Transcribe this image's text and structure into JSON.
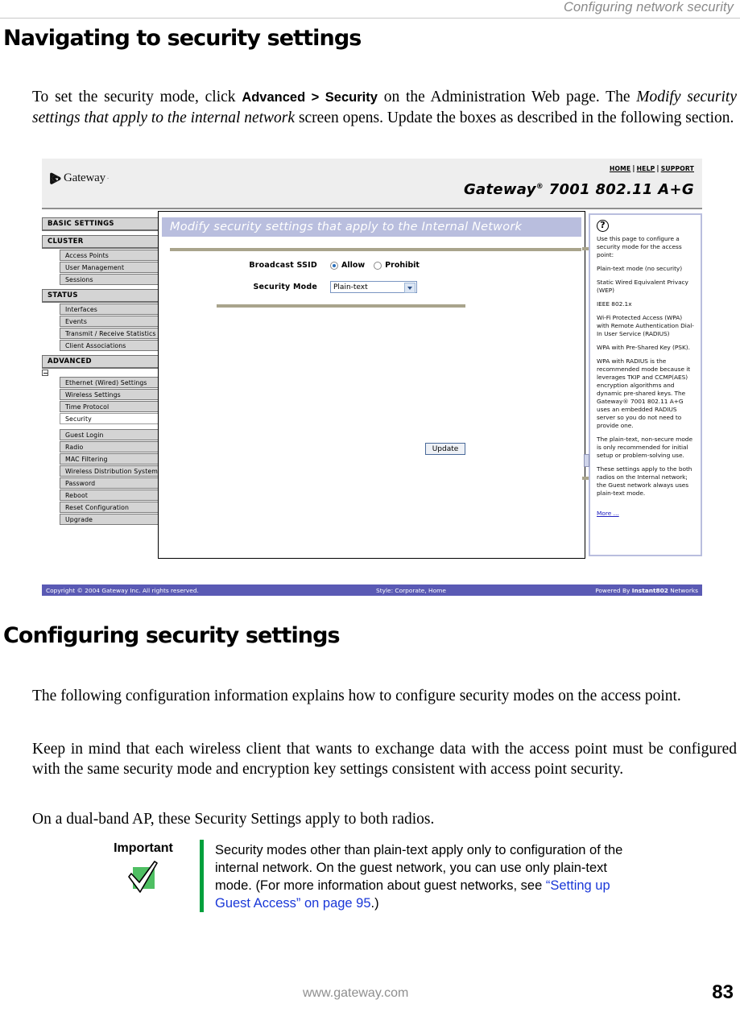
{
  "running_head": "Configuring network security",
  "sections": {
    "nav_heading": "Navigating to security settings",
    "nav_paragraph": {
      "part1": "To set the security mode, click ",
      "bold": "Advanced > Security",
      "part2": " on the Administration Web page. The ",
      "italic": "Modify security settings that apply to the internal network",
      "part3": " screen opens. Update the boxes as described in the following section."
    },
    "cfg_heading": "Configuring security settings",
    "cfg_p1": "The following configuration information explains how to configure security modes on the access point.",
    "cfg_p2": "Keep in mind that each wireless client that wants to exchange data with the access point must be configured with the same security mode and encryption key settings consistent with access point security.",
    "cfg_p3": "On a dual-band AP, these Security Settings apply to both radios."
  },
  "screenshot": {
    "header": {
      "logo_text": "Gateway",
      "logo_trademark": "·",
      "links": [
        {
          "label": "Home"
        },
        {
          "label": "Help"
        },
        {
          "label": "Support"
        }
      ],
      "separator": "|",
      "product": "Gateway",
      "product_sup": "®",
      "product_rest": " 7001 802.11 A+G"
    },
    "nav": {
      "groups": [
        {
          "head": "BASIC SETTINGS",
          "items": []
        },
        {
          "head": "CLUSTER",
          "items": [
            {
              "label": "Access Points",
              "selected": false
            },
            {
              "label": "User Management",
              "selected": false
            },
            {
              "label": "Sessions",
              "selected": false
            }
          ]
        },
        {
          "head": "STATUS",
          "items": [
            {
              "label": "Interfaces",
              "selected": false
            },
            {
              "label": "Events",
              "selected": false
            },
            {
              "label": "Transmit / Receive Statistics",
              "selected": false
            },
            {
              "label": "Client Associations",
              "selected": false
            }
          ]
        },
        {
          "head": "ADVANCED",
          "items": [
            {
              "label": "Ethernet (Wired) Settings",
              "selected": false
            },
            {
              "label": "Wireless Settings",
              "selected": false
            },
            {
              "label": "Time Protocol",
              "selected": false
            },
            {
              "label": "Security",
              "selected": true
            },
            {
              "label": "Guest Login",
              "selected": false
            },
            {
              "label": "Radio",
              "selected": false
            },
            {
              "label": "MAC Filtering",
              "selected": false
            },
            {
              "label": "Wireless Distribution System",
              "selected": false
            },
            {
              "label": "Password",
              "selected": false
            },
            {
              "label": "Reboot",
              "selected": false
            },
            {
              "label": "Reset Configuration",
              "selected": false
            },
            {
              "label": "Upgrade",
              "selected": false
            }
          ]
        }
      ]
    },
    "panel": {
      "title": "Modify security settings that apply to the Internal Network",
      "broadcast_ssid_label": "Broadcast SSID",
      "radio_allow": "Allow",
      "radio_prohibit": "Prohibit",
      "radio_selected": "Allow",
      "security_mode_label": "Security Mode",
      "security_mode_value": "Plain-text",
      "update_button": "Update"
    },
    "help": {
      "icon": "question-mark-icon",
      "paragraphs": [
        "Use this page to configure a security mode for the access point:",
        "Plain-text mode (no security)",
        "Static Wired Equivalent Privacy (WEP)",
        "IEEE 802.1x",
        "Wi-Fi Protected Access (WPA) with Remote Authentication Dial-In User Service (RADIUS)",
        "WPA with Pre-Shared Key (PSK).",
        "WPA with RADIUS is the recommended mode because it leverages TKIP and CCMP(AES) encryption algorithms and dynamic pre-shared keys. The Gateway® 7001 802.11 A+G uses an embedded RADIUS server so you do not need to provide one.",
        "The plain-text, non-secure mode is only recommended for initial setup or problem-solving use.",
        "These settings apply to the both radios on the Internal network; the Guest network always uses plain-text mode."
      ],
      "more_link": "More ..."
    },
    "footer": {
      "copyright": "Copyright © 2004 Gateway Inc. All rights reserved.",
      "style": "Style: Corporate, Home",
      "powered_prefix": "Powered By ",
      "powered_brand": "Instant802",
      "powered_suffix": " Networks"
    }
  },
  "callout": {
    "title": "Important",
    "icon": "green-checkmark-icon",
    "text_part1": "Security modes other than plain-text apply only to configuration of the internal network. On the guest network, you can use only plain-text mode. (For more information about guest networks, see ",
    "link": "“Setting up Guest Access” on page 95",
    "text_part2": ".)"
  },
  "page_footer": {
    "url": "www.gateway.com",
    "page_number": "83"
  },
  "colors": {
    "accent_blue": "#5a5ab4",
    "panel_title_bg": "#b9bede",
    "divider_tan": "#a9a48c",
    "callout_green": "#00a03c",
    "link_blue": "#1a38d8"
  }
}
